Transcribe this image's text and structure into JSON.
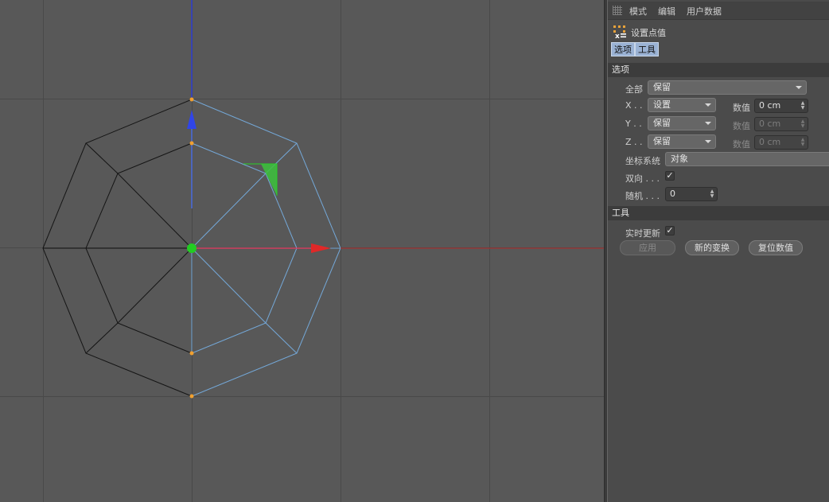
{
  "menubar": {
    "items": [
      "模式",
      "编辑",
      "用户数据"
    ]
  },
  "tool": {
    "title": "设置点值",
    "icon": "set-point-value-icon"
  },
  "tabs": [
    "选项",
    "工具"
  ],
  "options_section": {
    "heading": "选项",
    "all_label": "全部",
    "all_value": "保留",
    "x_label": "X . .",
    "x_mode": "设置",
    "x_value_label": "数值",
    "x_value": "0 cm",
    "y_label": "Y . .",
    "y_mode": "保留",
    "y_value_label": "数值",
    "y_value": "0 cm",
    "z_label": "Z . .",
    "z_mode": "保留",
    "z_value_label": "数值",
    "z_value": "0 cm",
    "coord_label": "坐标系统",
    "coord_value": "对象",
    "bidirectional_label": "双向 . . .",
    "bidirectional_checked": true,
    "random_label": "随机 . . .",
    "random_value": "0"
  },
  "tool_section": {
    "heading": "工具",
    "realtime_label": "实时更新",
    "realtime_checked": true,
    "apply_label": "应用",
    "new_transform_label": "新的变换",
    "reset_label": "复位数值"
  },
  "viewport": {
    "background": "#585858",
    "grid_color": "#4a4a4a",
    "selected_edge_color": "#6fa8dc",
    "edge_color": "#111111",
    "axis_x_color": "#e23232",
    "axis_y_color": "#2f3fe0",
    "axis_z_color": "#22cc22",
    "point_color": "#f0a030"
  }
}
